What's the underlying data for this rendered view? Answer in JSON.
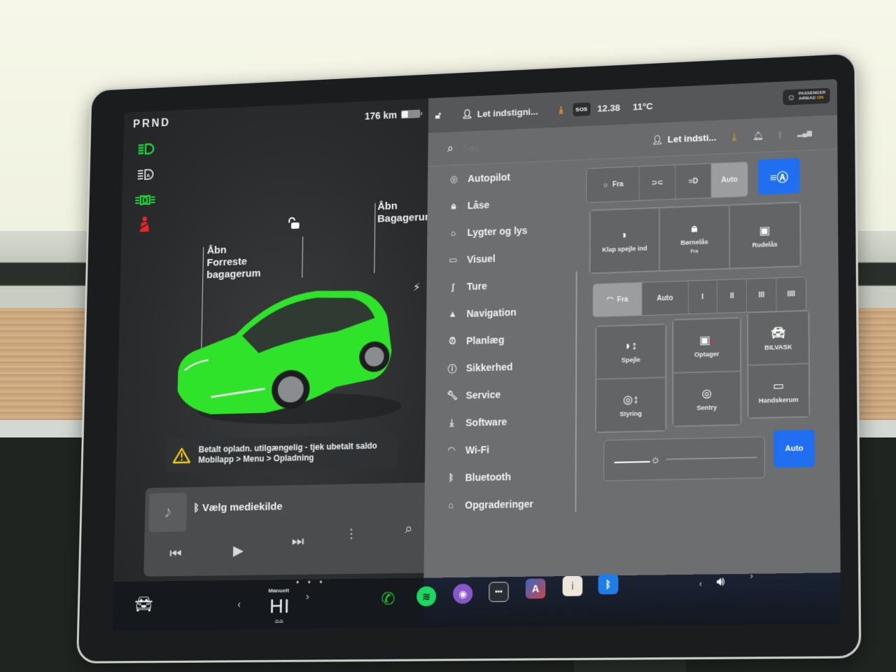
{
  "status": {
    "gear": "PRND",
    "range": "176 km",
    "profile_top": "Let indstigni...",
    "profile_header": "Let indsti...",
    "time": "12.38",
    "temperature": "11°C",
    "sos_label": "SOS",
    "airbag_line1": "PASSENGER",
    "airbag_line2": "AIRBAG",
    "airbag_state": "ON"
  },
  "telltales": [
    {
      "icon": "low-beam-icon",
      "color": "#22d93a"
    },
    {
      "icon": "auto-high-beam-icon",
      "color": "#d8d8d8"
    },
    {
      "icon": "parking-lights-icon",
      "color": "#22d93a"
    },
    {
      "icon": "seatbelt-warning-icon",
      "color": "#e8262a"
    }
  ],
  "car": {
    "frunk_label": "Åbn\nForreste\nbagagerum",
    "frunk_l1": "Åbn",
    "frunk_l2": "Forreste",
    "frunk_l3": "bagagerum",
    "trunk_l1": "Åbn",
    "trunk_l2": "Bagagerum",
    "body_color": "#2fe22a"
  },
  "alert": {
    "line1": "Betalt opladn. utilgængelig - tjek ubetalt saldo",
    "line2": "Mobilapp > Menu > Opladning"
  },
  "media": {
    "title": "Vælg mediekilde",
    "source_icon": "bluetooth-icon"
  },
  "search": {
    "placeholder": "Søg"
  },
  "menu": [
    {
      "label": "Autopilot",
      "icon": "steering-wheel-icon",
      "glyph": "◎"
    },
    {
      "label": "Låse",
      "icon": "lock-icon",
      "glyph": "🔒︎"
    },
    {
      "label": "Lygter og lys",
      "icon": "light-icon",
      "glyph": "☼"
    },
    {
      "label": "Visuel",
      "icon": "display-icon",
      "glyph": "▭"
    },
    {
      "label": "Ture",
      "icon": "trips-icon",
      "glyph": "ʃ"
    },
    {
      "label": "Navigation",
      "icon": "navigation-icon",
      "glyph": "▲"
    },
    {
      "label": "Planlæg",
      "icon": "schedule-icon",
      "glyph": "⏰︎"
    },
    {
      "label": "Sikkerhed",
      "icon": "safety-icon",
      "glyph": "ⓘ"
    },
    {
      "label": "Service",
      "icon": "wrench-icon",
      "glyph": "🔧︎"
    },
    {
      "label": "Software",
      "icon": "download-icon",
      "glyph": "⤓"
    },
    {
      "label": "Wi-Fi",
      "icon": "wifi-icon",
      "glyph": "◠"
    },
    {
      "label": "Bluetooth",
      "icon": "bluetooth-icon",
      "glyph": "ᛒ"
    },
    {
      "label": "Opgraderinger",
      "icon": "shopping-bag-icon",
      "glyph": "⌂"
    }
  ],
  "controls": {
    "lights": {
      "options": [
        "Fra",
        "",
        "",
        "Auto"
      ],
      "selected": "Auto",
      "auto_high_beam_active": true
    },
    "quick_row1": [
      {
        "label": "Klap spejle ind",
        "sub": "",
        "icon": "fold-mirror-icon",
        "glyph": "◗"
      },
      {
        "label": "Børnelås",
        "sub": "Fra",
        "icon": "child-lock-icon",
        "glyph": "🔒︎"
      },
      {
        "label": "Rudelås",
        "sub": "",
        "icon": "window-lock-icon",
        "glyph": "▣"
      }
    ],
    "wipers": {
      "options": [
        "Fra",
        "Auto",
        "I",
        "II",
        "III",
        "IIII"
      ],
      "selected": "Fra"
    },
    "quick_grid": [
      {
        "label": "Spejle",
        "icon": "mirror-adjust-icon",
        "glyph": "◗↕"
      },
      {
        "label": "Optager",
        "icon": "dashcam-icon",
        "glyph": "◉"
      },
      {
        "label": "BILVASK",
        "icon": "car-wash-icon",
        "glyph": "🚘︎"
      },
      {
        "label": "Styring",
        "icon": "steering-adjust-icon",
        "glyph": "◎↕"
      },
      {
        "label": "Sentry",
        "icon": "sentry-icon",
        "glyph": "◎"
      },
      {
        "label": "Handskerum",
        "icon": "glovebox-icon",
        "glyph": "▭"
      }
    ],
    "brightness": {
      "level_percent": 25,
      "auto_label": "Auto"
    }
  },
  "dock": {
    "climate_mode": "Manuelt",
    "climate_value": "HI",
    "apps": [
      {
        "name": "phone",
        "icon": "phone-icon",
        "color": "#1fd02c"
      },
      {
        "name": "spotify",
        "icon": "spotify-icon",
        "color": "#1ed760"
      },
      {
        "name": "camera",
        "icon": "camera-icon",
        "color": "#8a57c8"
      },
      {
        "name": "more",
        "icon": "more-icon",
        "color": "#2a2d33"
      },
      {
        "name": "toybox",
        "icon": "toybox-icon",
        "color": "#3a68c8"
      },
      {
        "name": "release-notes",
        "icon": "release-notes-icon",
        "color": "#ece7d8"
      },
      {
        "name": "bluetooth",
        "icon": "bluetooth-app-icon",
        "color": "#1f7de8"
      }
    ],
    "more_label": "•••",
    "notes_label": "i"
  }
}
